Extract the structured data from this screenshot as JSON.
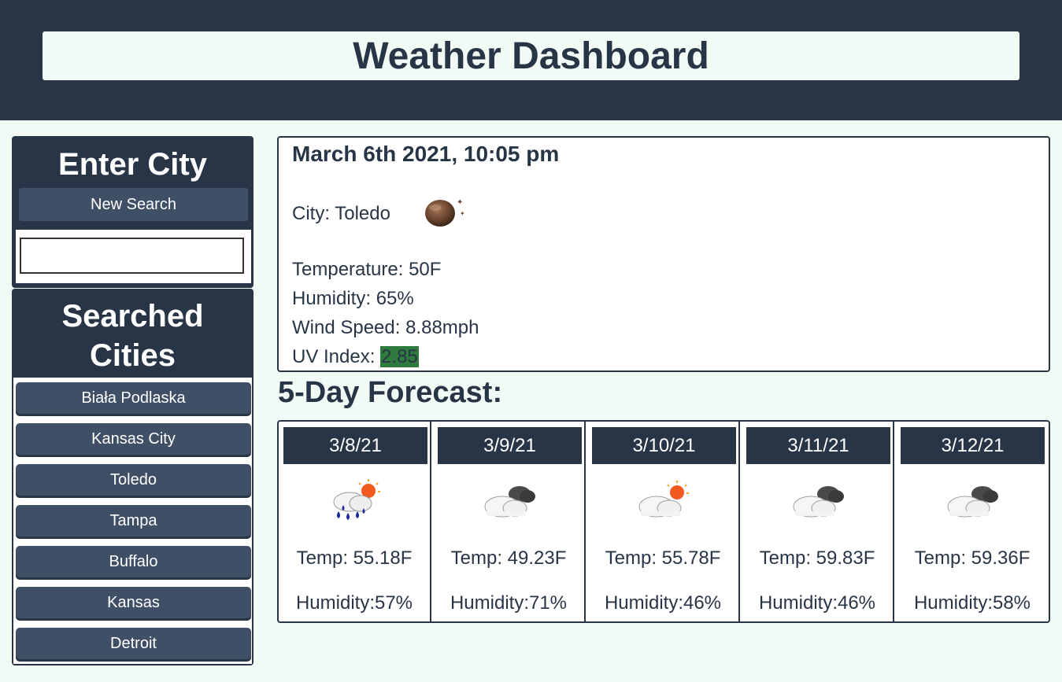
{
  "header": {
    "title": "Weather Dashboard"
  },
  "sidebar": {
    "enter_title": "Enter City",
    "new_search_label": "New Search",
    "search_value": "",
    "searched_title_line1": "Searched",
    "searched_title_line2": "Cities",
    "cities": [
      "Biała Podlaska",
      "Kansas City",
      "Toledo",
      "Tampa",
      "Buffalo",
      "Kansas",
      "Detroit"
    ]
  },
  "current": {
    "datetime": "March 6th 2021, 10:05 pm",
    "city": "City: Toledo",
    "icon": "night-clear-moon-icon",
    "temperature": "Temperature: 50F",
    "humidity": "Humidity: 65%",
    "wind": "Wind Speed: 8.88mph",
    "uv_label": "UV Index: ",
    "uv_value": "2.85",
    "uv_color": "#2f7a3d"
  },
  "forecast": {
    "title": "5-Day Forecast:",
    "days": [
      {
        "date": "3/8/21",
        "icon": "rain-sun-icon",
        "temp": "Temp: 55.18F",
        "humidity": "Humidity:57%"
      },
      {
        "date": "3/9/21",
        "icon": "cloudy-icon",
        "temp": "Temp: 49.23F",
        "humidity": "Humidity:71%"
      },
      {
        "date": "3/10/21",
        "icon": "partly-sunny-icon",
        "temp": "Temp: 55.78F",
        "humidity": "Humidity:46%"
      },
      {
        "date": "3/11/21",
        "icon": "cloudy-icon",
        "temp": "Temp: 59.83F",
        "humidity": "Humidity:46%"
      },
      {
        "date": "3/12/21",
        "icon": "cloudy-icon",
        "temp": "Temp: 59.36F",
        "humidity": "Humidity:58%"
      }
    ]
  },
  "colors": {
    "dark": "#283547",
    "button": "#3f4f66",
    "background": "#f1faf4"
  }
}
